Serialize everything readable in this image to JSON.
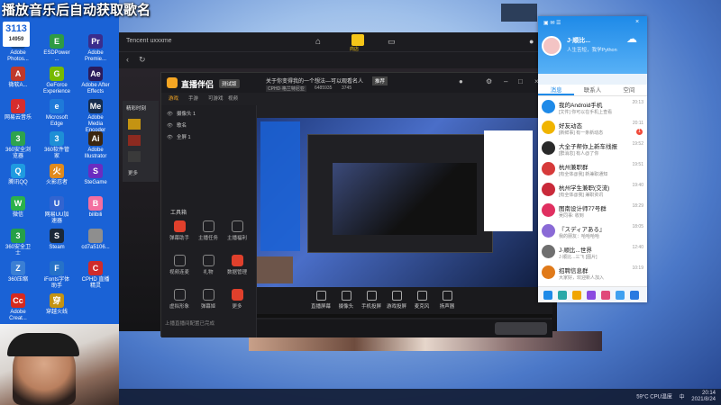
{
  "stream_banner": "播放音乐后自动获取歌名",
  "logo_text": "3113",
  "logo_count": "14959",
  "desktop": {
    "icons": [
      {
        "label": "Adobe Photos...",
        "c": "#1a4b8c",
        "g": "Ps"
      },
      {
        "label": "ESDPower ...",
        "c": "#2e9b44",
        "g": "E"
      },
      {
        "label": "Adobe Premie...",
        "c": "#3a2d8c",
        "g": "Pr"
      },
      {
        "label": "微软A...",
        "c": "#c0392b",
        "g": "A"
      },
      {
        "label": "GeForce Experience",
        "c": "#76b900",
        "g": "G"
      },
      {
        "label": "Adobe After Effects",
        "c": "#2b1b5c",
        "g": "Ae"
      },
      {
        "label": "网易云音乐",
        "c": "#d62d2d",
        "g": "♪"
      },
      {
        "label": "Microsoft Edge",
        "c": "#1f7ad9",
        "g": "e"
      },
      {
        "label": "Adobe Media Encoder",
        "c": "#162d4d",
        "g": "Me"
      },
      {
        "label": "360安全浏览器",
        "c": "#2ea34e",
        "g": "3"
      },
      {
        "label": "360软件管家",
        "c": "#1e8fd6",
        "g": "3"
      },
      {
        "label": "Adobe Illustrator",
        "c": "#3b2610",
        "g": "Ai"
      },
      {
        "label": "腾讯QQ",
        "c": "#1f9be0",
        "g": "Q"
      },
      {
        "label": "火影忍者",
        "c": "#e08a1c",
        "g": "火"
      },
      {
        "label": "SteGame",
        "c": "#6a2cc0",
        "g": "S"
      },
      {
        "label": "微信",
        "c": "#2bb14a",
        "g": "W"
      },
      {
        "label": "网易UU加速器",
        "c": "#3264d0",
        "g": "U"
      },
      {
        "label": "bilibili",
        "c": "#f36fa0",
        "g": "B"
      },
      {
        "label": "360安全卫士",
        "c": "#26a048",
        "g": "3"
      },
      {
        "label": "Steam",
        "c": "#1b2838",
        "g": "S"
      },
      {
        "label": "cd7a5106...",
        "c": "#8e8e8e",
        "g": ""
      },
      {
        "label": "360压缩",
        "c": "#3b7fd4",
        "g": "Z"
      },
      {
        "label": "iFonts字体助手",
        "c": "#2672c8",
        "g": "F"
      },
      {
        "label": "CPHD 直播精灵",
        "c": "#d02b2b",
        "g": "C"
      },
      {
        "label": "Adobe Creat...",
        "c": "#d6291e",
        "g": "Cc"
      },
      {
        "label": "穿越火线",
        "c": "#c49312",
        "g": "穿"
      }
    ]
  },
  "tencent": {
    "title": "Tencent uxxxme",
    "nav": {
      "home": "",
      "store": "商店",
      "controller": ""
    }
  },
  "zhibo": {
    "app_name": "直播伴侣",
    "version": "测试版",
    "tabs": [
      "游戏",
      "手游",
      "可游戏",
      "视频"
    ],
    "scene_title": "关于你变得我的一个想法—可以观看名人",
    "scene_badge": "推荐",
    "scene_sub1": "CPHD·格兰特尼亚",
    "scene_sub2": "6485935",
    "scene_sub3": "3745",
    "scenes": [
      {
        "label": "摄像头 1"
      },
      {
        "label": "歌名"
      },
      {
        "label": "全屏 1"
      }
    ],
    "tools_title": "工具箱",
    "tools": [
      {
        "label": "弹幕助手",
        "red": true
      },
      {
        "label": "主播任务",
        "red": false
      },
      {
        "label": "主播福利",
        "red": false
      },
      {
        "label": "视频连麦",
        "red": false
      },
      {
        "label": "礼物",
        "red": false
      },
      {
        "label": "数据管理",
        "red": true
      },
      {
        "label": "虚拟形象",
        "red": false
      },
      {
        "label": "弹幕姬",
        "red": false
      },
      {
        "label": "更多",
        "red": true
      }
    ],
    "bottom_tools": [
      "直播屏幕",
      "摄像头",
      "手机投屏",
      "游戏投屏",
      "麦克风",
      "扬声器"
    ],
    "status_line": "上播直播间配置已完成",
    "game_list": [
      "精彩时刻",
      "更多"
    ]
  },
  "qq": {
    "username": "J·顺比...",
    "status": "人生苦短，我学Python",
    "tabs": [
      "消息",
      "联系人",
      "空间"
    ],
    "rows": [
      {
        "name": "我的Android手机",
        "preview": "[文件] 你可以在手机上查看",
        "time": "20:13",
        "badge": "",
        "c": "#1e8ae8"
      },
      {
        "name": "好友动态",
        "preview": "[新鲜事] 有一条新动态",
        "time": "20:11",
        "badge": "1",
        "c": "#f0b400"
      },
      {
        "name": "大全子帮你上新车线报",
        "preview": "[群消息] 有人@了你",
        "time": "19:52",
        "badge": "",
        "c": "#2a2a2a"
      },
      {
        "name": "杭州兼职群",
        "preview": "[有全体@我] 新兼职通知",
        "time": "19:51",
        "badge": "",
        "c": "#d63a3a"
      },
      {
        "name": "杭州学生兼职(交流)",
        "preview": "[有全体@我] 兼职资讯",
        "time": "19:40",
        "badge": "",
        "c": "#c92a3a"
      },
      {
        "name": "图南设计师77号群",
        "preview": "吴同事: 收到",
        "time": "18:29",
        "badge": "",
        "c": "#e03060"
      },
      {
        "name": "『スディアある』",
        "preview": "我的朋友：哈哈哈哈",
        "time": "18:05",
        "badge": "",
        "c": "#8a6ad6"
      },
      {
        "name": "J·顺比...世界",
        "preview": "J·顺比...三飞 [图片]",
        "time": "12:40",
        "badge": "",
        "c": "#6f6f6f"
      },
      {
        "name": "招聘信息群",
        "preview": "大家好，欢迎新人加入",
        "time": "10:19",
        "badge": "",
        "c": "#e07a1a"
      }
    ],
    "foot_icons": [
      "contacts-icon",
      "group-icon",
      "space-icon",
      "game-icon",
      "mail-icon",
      "cloud-icon",
      "shield-icon"
    ]
  },
  "taskbar": {
    "temp": "59°C",
    "cpu_label": "CPU温度",
    "time": "20:14",
    "date": "2021/8/24",
    "lang": "中"
  }
}
